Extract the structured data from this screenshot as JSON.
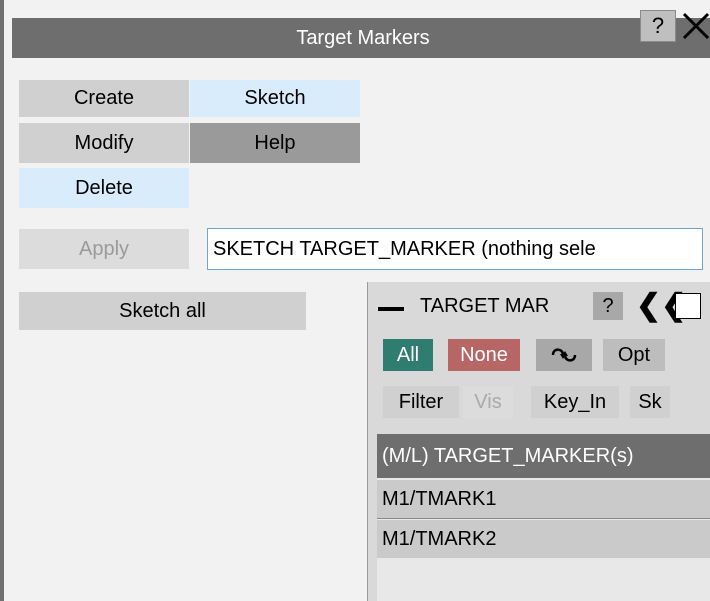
{
  "window": {
    "title": "Target Markers",
    "help": "?",
    "close": "✕"
  },
  "menu": {
    "create": "Create",
    "sketch": "Sketch",
    "modify": "Modify",
    "help": "Help",
    "delete": "Delete"
  },
  "apply": "Apply",
  "command": "SKETCH TARGET_MARKER (nothing sele",
  "sketch_all": "Sketch all",
  "panel": {
    "title": "TARGET MAR",
    "help": "?",
    "collapse_glyph": "❮❮",
    "buttons": {
      "all": "All",
      "none": "None",
      "swap": "⬿⬀",
      "opt": "Opt",
      "filter": "Filter",
      "vis": "Vis",
      "key_in": "Key_In",
      "sk": "Sk"
    },
    "list": {
      "header": "(M/L) TARGET_MARKER(s)",
      "items": [
        "M1/TMARK1",
        "M1/TMARK2"
      ]
    }
  },
  "colors": {
    "all_btn": "#2e7d70",
    "none_btn": "#b86565",
    "title_bar": "#6e6e6e"
  }
}
